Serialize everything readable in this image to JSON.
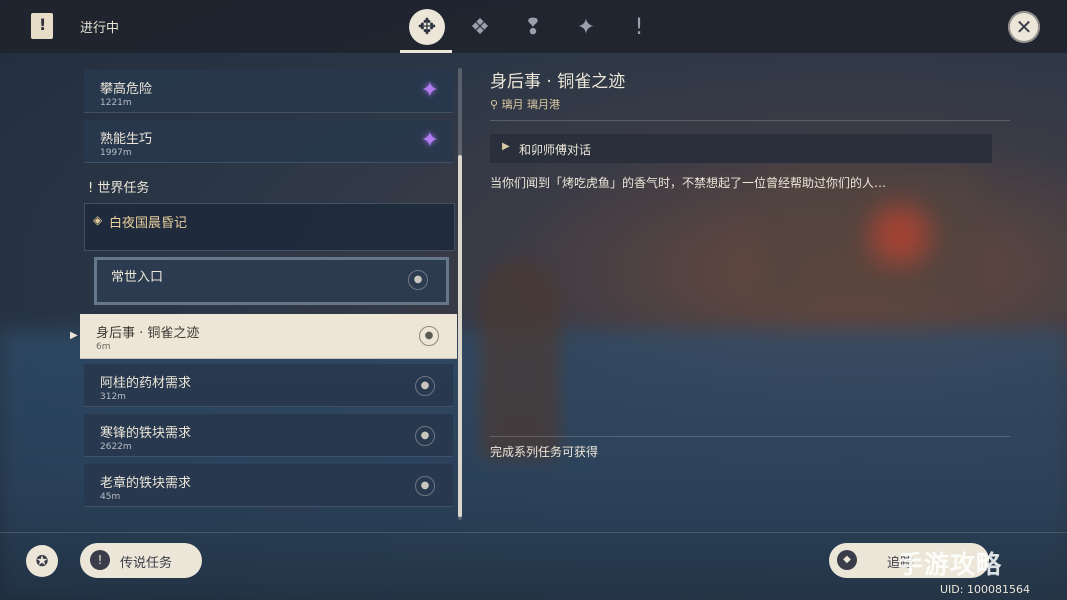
{
  "topbar": {
    "title": "进行中",
    "tabs": [
      {
        "icon": "archon-quest-icon",
        "glyph": "✥",
        "active": true
      },
      {
        "icon": "story-quest-icon",
        "glyph": "❖",
        "active": false
      },
      {
        "icon": "world-quest-diamond-icon",
        "glyph": "❢",
        "active": false
      },
      {
        "icon": "commission-quest-icon",
        "glyph": "✦",
        "active": false
      },
      {
        "icon": "world-quest-icon",
        "glyph": "!",
        "active": false
      }
    ],
    "close_glyph": "✕"
  },
  "list": {
    "items_top": [
      {
        "name": "攀高危险",
        "dist": "1221m"
      },
      {
        "name": "熟能生巧",
        "dist": "1997m"
      }
    ],
    "section_label": "世界任务",
    "group_name": "白夜国晨昏记",
    "sub_item": "常世入口",
    "selected": {
      "name": "身后事 · 铜雀之迹",
      "dist": "6m"
    },
    "items_bottom": [
      {
        "name": "阿桂的药材需求",
        "dist": "312m"
      },
      {
        "name": "寒锋的铁块需求",
        "dist": "2622m"
      },
      {
        "name": "老章的铁块需求",
        "dist": "45m"
      }
    ]
  },
  "detail": {
    "title": "身后事 · 铜雀之迹",
    "location": "璃月 璃月港",
    "objective": "和卯师傅对话",
    "description": "当你们闻到「烤吃虎鱼」的香气时，不禁想起了一位曾经帮助过你们的人…",
    "reward_label": "完成系列任务可获得"
  },
  "bottom": {
    "legend_button": "传说任务",
    "track_button": "追踪"
  },
  "uid": "UID: 100081564",
  "watermark": "手游攻略"
}
